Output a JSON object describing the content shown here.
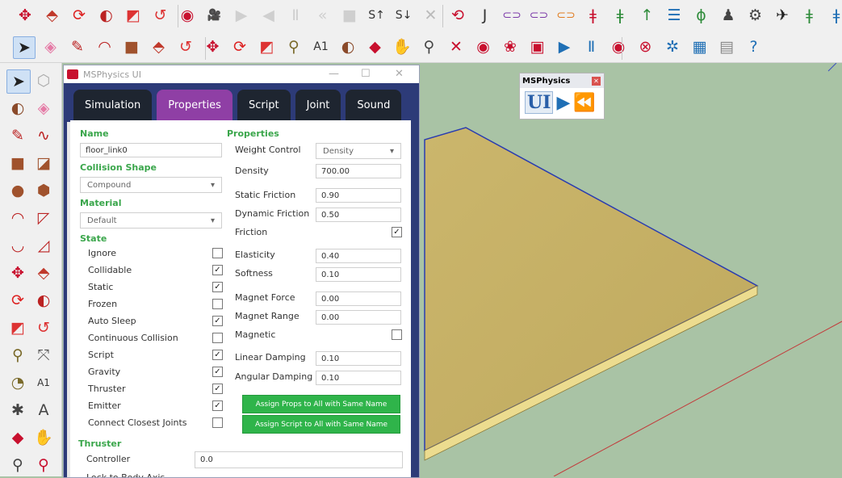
{
  "toolbar_top": [
    {
      "name": "move-icon",
      "glyph": "✥",
      "color": "#c8102e"
    },
    {
      "name": "push-pull-icon",
      "glyph": "⬘",
      "color": "#c0392b"
    },
    {
      "name": "rotate-icon",
      "glyph": "⟳",
      "color": "#d22"
    },
    {
      "name": "follow-me-icon",
      "glyph": "◐",
      "color": "#b22"
    },
    {
      "name": "scale-icon",
      "glyph": "◩",
      "color": "#d33"
    },
    {
      "name": "offset-icon",
      "glyph": "↺",
      "color": "#d33"
    },
    {
      "name": "record-icon",
      "glyph": "◉",
      "color": "#c8102e"
    },
    {
      "name": "camera-icon",
      "glyph": "🎥",
      "color": "#444"
    },
    {
      "name": "play-icon",
      "glyph": "▶",
      "color": "#cfcfcf"
    },
    {
      "name": "step-back-icon",
      "glyph": "◀",
      "color": "#cfcfcf"
    },
    {
      "name": "pause-icon",
      "glyph": "Ⅱ",
      "color": "#cfcfcf"
    },
    {
      "name": "rewind-icon",
      "glyph": "«",
      "color": "#cfcfcf"
    },
    {
      "name": "stop-icon",
      "glyph": "■",
      "color": "#cfcfcf"
    },
    {
      "name": "select-up-icon",
      "glyph": "S↑",
      "color": "#333"
    },
    {
      "name": "select-down-icon",
      "glyph": "S↓",
      "color": "#333"
    },
    {
      "name": "clear-icon",
      "glyph": "✕",
      "color": "#bbb"
    },
    {
      "name": "refresh-icon",
      "glyph": "⟲",
      "color": "#c8102e"
    },
    {
      "name": "joint-icon",
      "glyph": "J",
      "color": "#333"
    },
    {
      "name": "link-icon",
      "glyph": "⊂⊃",
      "color": "#7c3aa8"
    },
    {
      "name": "link-icon-2",
      "glyph": "⊂⊃",
      "color": "#7c3aa8"
    },
    {
      "name": "link-orange-icon",
      "glyph": "⊂⊃",
      "color": "#e07b1f"
    },
    {
      "name": "piston-red-icon",
      "glyph": "ǂ",
      "color": "#c8102e"
    },
    {
      "name": "piston-green-icon",
      "glyph": "ǂ",
      "color": "#2e8b3a"
    },
    {
      "name": "arrow-up-icon",
      "glyph": "↑",
      "color": "#2e8b3a"
    },
    {
      "name": "spring-icon",
      "glyph": "☰",
      "color": "#1f6fb5"
    },
    {
      "name": "hinge-icon",
      "glyph": "ϕ",
      "color": "#2e8b3a"
    },
    {
      "name": "weight-icon",
      "glyph": "♟",
      "color": "#444"
    },
    {
      "name": "gear-icon",
      "glyph": "⚙",
      "color": "#444"
    },
    {
      "name": "plane-icon",
      "glyph": "✈",
      "color": "#222"
    },
    {
      "name": "slider-green-icon",
      "glyph": "ǂ",
      "color": "#2e8b3a"
    },
    {
      "name": "slider-blue-icon",
      "glyph": "ǂ",
      "color": "#1f6fb5"
    }
  ],
  "toolbar_second": [
    {
      "name": "select-arrow-icon",
      "glyph": "➤",
      "color": "#222"
    },
    {
      "name": "eraser-icon",
      "glyph": "◈",
      "color": "#e57ba6"
    },
    {
      "name": "pencil-icon",
      "glyph": "✎",
      "color": "#b22"
    },
    {
      "name": "arc-icon",
      "glyph": "◠",
      "color": "#b22"
    },
    {
      "name": "rectangle-icon",
      "glyph": "■",
      "color": "#a0522d"
    },
    {
      "name": "push-pull-icon",
      "glyph": "⬘",
      "color": "#c0392b"
    },
    {
      "name": "offset-icon",
      "glyph": "↺",
      "color": "#d33"
    },
    {
      "name": "move-icon",
      "glyph": "✥",
      "color": "#c8102e"
    },
    {
      "name": "rotate-icon",
      "glyph": "⟳",
      "color": "#d22"
    },
    {
      "name": "scale-icon",
      "glyph": "◩",
      "color": "#d33"
    },
    {
      "name": "tape-measure-icon",
      "glyph": "⚲",
      "color": "#7a6a2a"
    },
    {
      "name": "text-icon",
      "glyph": "A1",
      "color": "#333"
    },
    {
      "name": "paint-bucket-icon",
      "glyph": "◐",
      "color": "#8a4a2a"
    },
    {
      "name": "orbit-icon",
      "glyph": "◆",
      "color": "#c8102e"
    },
    {
      "name": "pan-icon",
      "glyph": "✋",
      "color": "#c9a06a"
    },
    {
      "name": "zoom-icon",
      "glyph": "⚲",
      "color": "#444"
    },
    {
      "name": "zoom-extents-icon",
      "glyph": "✕",
      "color": "#c8102e"
    },
    {
      "name": "component-icon",
      "glyph": "◉",
      "color": "#c8102e"
    },
    {
      "name": "warehouse-icon",
      "glyph": "❀",
      "color": "#c8102e"
    },
    {
      "name": "extension-icon",
      "glyph": "▣",
      "color": "#c8102e"
    },
    {
      "name": "play-icon",
      "glyph": "▶",
      "color": "#1f6fb5"
    },
    {
      "name": "pause-icon",
      "glyph": "Ⅱ",
      "color": "#1f6fb5"
    },
    {
      "name": "record-icon",
      "glyph": "◉",
      "color": "#c8102e"
    },
    {
      "name": "reset-icon",
      "glyph": "⊗",
      "color": "#c8102e"
    },
    {
      "name": "settings-icon",
      "glyph": "✲",
      "color": "#1f6fb5"
    },
    {
      "name": "film-icon",
      "glyph": "▦",
      "color": "#1f6fb5"
    },
    {
      "name": "preferences-icon",
      "glyph": "▤",
      "color": "#888"
    },
    {
      "name": "help-icon",
      "glyph": "?",
      "color": "#1f6fb5"
    }
  ],
  "palette": [
    [
      "select-arrow-icon",
      "➤",
      "#222"
    ],
    [
      "component-icon",
      "⬡",
      "#aaa"
    ],
    [
      "paint-bucket-icon",
      "◐",
      "#8a4a2a"
    ],
    [
      "eraser-icon",
      "◈",
      "#e57ba6"
    ],
    [
      "pencil-icon",
      "✎",
      "#b22"
    ],
    [
      "freehand-icon",
      "∿",
      "#b22"
    ],
    [
      "rectangle-icon",
      "■",
      "#a0522d"
    ],
    [
      "rotated-rectangle-icon",
      "◪",
      "#a0522d"
    ],
    [
      "circle-icon",
      "●",
      "#a0522d"
    ],
    [
      "polygon-icon",
      "⬢",
      "#a0522d"
    ],
    [
      "arc-icon",
      "◠",
      "#b22"
    ],
    [
      "pie-icon",
      "◸",
      "#b22"
    ],
    [
      "arc-3pt-icon",
      "◡",
      "#b22"
    ],
    [
      "pie-3pt-icon",
      "◿",
      "#b22"
    ],
    [
      "move-icon",
      "✥",
      "#c8102e"
    ],
    [
      "push-pull-icon",
      "⬘",
      "#c0392b"
    ],
    [
      "rotate-icon",
      "⟳",
      "#d22"
    ],
    [
      "follow-me-icon",
      "◐",
      "#b22"
    ],
    [
      "scale-icon",
      "◩",
      "#d33"
    ],
    [
      "offset-icon",
      "↺",
      "#d33"
    ],
    [
      "tape-measure-icon",
      "⚲",
      "#7a6a2a"
    ],
    [
      "dimension-icon",
      "⤧",
      "#555"
    ],
    [
      "protractor-icon",
      "◔",
      "#7a6a2a"
    ],
    [
      "text-icon",
      "A1",
      "#333"
    ],
    [
      "axes-icon",
      "✱",
      "#444"
    ],
    [
      "3d-text-icon",
      "A",
      "#444"
    ],
    [
      "orbit-icon",
      "◆",
      "#c8102e"
    ],
    [
      "pan-icon",
      "✋",
      "#c9a06a"
    ],
    [
      "zoom-icon",
      "⚲",
      "#444"
    ],
    [
      "zoom-window-icon",
      "⚲",
      "#c8102e"
    ]
  ],
  "window": {
    "title": "MSPhysics UI",
    "tabs": [
      "Simulation",
      "Properties",
      "Script",
      "Joint",
      "Sound"
    ],
    "active_tab": "Properties"
  },
  "form": {
    "name_heading": "Name",
    "name_value": "floor_link0",
    "collision_heading": "Collision Shape",
    "collision_value": "Compound",
    "material_heading": "Material",
    "material_value": "Default",
    "state_heading": "State",
    "state_items": [
      {
        "label": "Ignore",
        "checked": false
      },
      {
        "label": "Collidable",
        "checked": true
      },
      {
        "label": "Static",
        "checked": true
      },
      {
        "label": "Frozen",
        "checked": false
      },
      {
        "label": "Auto Sleep",
        "checked": true
      },
      {
        "label": "Continuous Collision",
        "checked": false
      },
      {
        "label": "Script",
        "checked": true
      },
      {
        "label": "Gravity",
        "checked": true
      },
      {
        "label": "Thruster",
        "checked": true
      },
      {
        "label": "Emitter",
        "checked": true
      },
      {
        "label": "Connect Closest Joints",
        "checked": false
      }
    ],
    "properties_heading": "Properties",
    "weight_control_label": "Weight Control",
    "weight_control_value": "Density",
    "density_label": "Density",
    "density_value": "700.00",
    "static_friction_label": "Static Friction",
    "static_friction_value": "0.90",
    "dynamic_friction_label": "Dynamic Friction",
    "dynamic_friction_value": "0.50",
    "friction_label": "Friction",
    "friction_checked": true,
    "elasticity_label": "Elasticity",
    "elasticity_value": "0.40",
    "softness_label": "Softness",
    "softness_value": "0.10",
    "magnet_force_label": "Magnet Force",
    "magnet_force_value": "0.00",
    "magnet_range_label": "Magnet Range",
    "magnet_range_value": "0.00",
    "magnetic_label": "Magnetic",
    "magnetic_checked": false,
    "linear_damping_label": "Linear Damping",
    "linear_damping_value": "0.10",
    "angular_damping_label": "Angular Damping",
    "angular_damping_value": "0.10",
    "assign_props_button": "Assign Props to All with Same Name",
    "assign_script_button": "Assign Script to All with Same Name",
    "thruster_heading": "Thruster",
    "controller_label": "Controller",
    "controller_value": "0.0",
    "lock_label": "Lock to Body Axis"
  },
  "mini_toolbar": {
    "title": "MSPhysics",
    "ui_label": "UI"
  },
  "colors": {
    "tab_active": "#8f3fa5",
    "tab_inactive": "#1e2530",
    "window_bg": "#2d3b78",
    "heading_green": "#3aa64b",
    "button_green": "#2fb44a",
    "floor_top": "#c9b56b",
    "floor_edge": "#e6d58a",
    "background": "#a9c3a5"
  }
}
